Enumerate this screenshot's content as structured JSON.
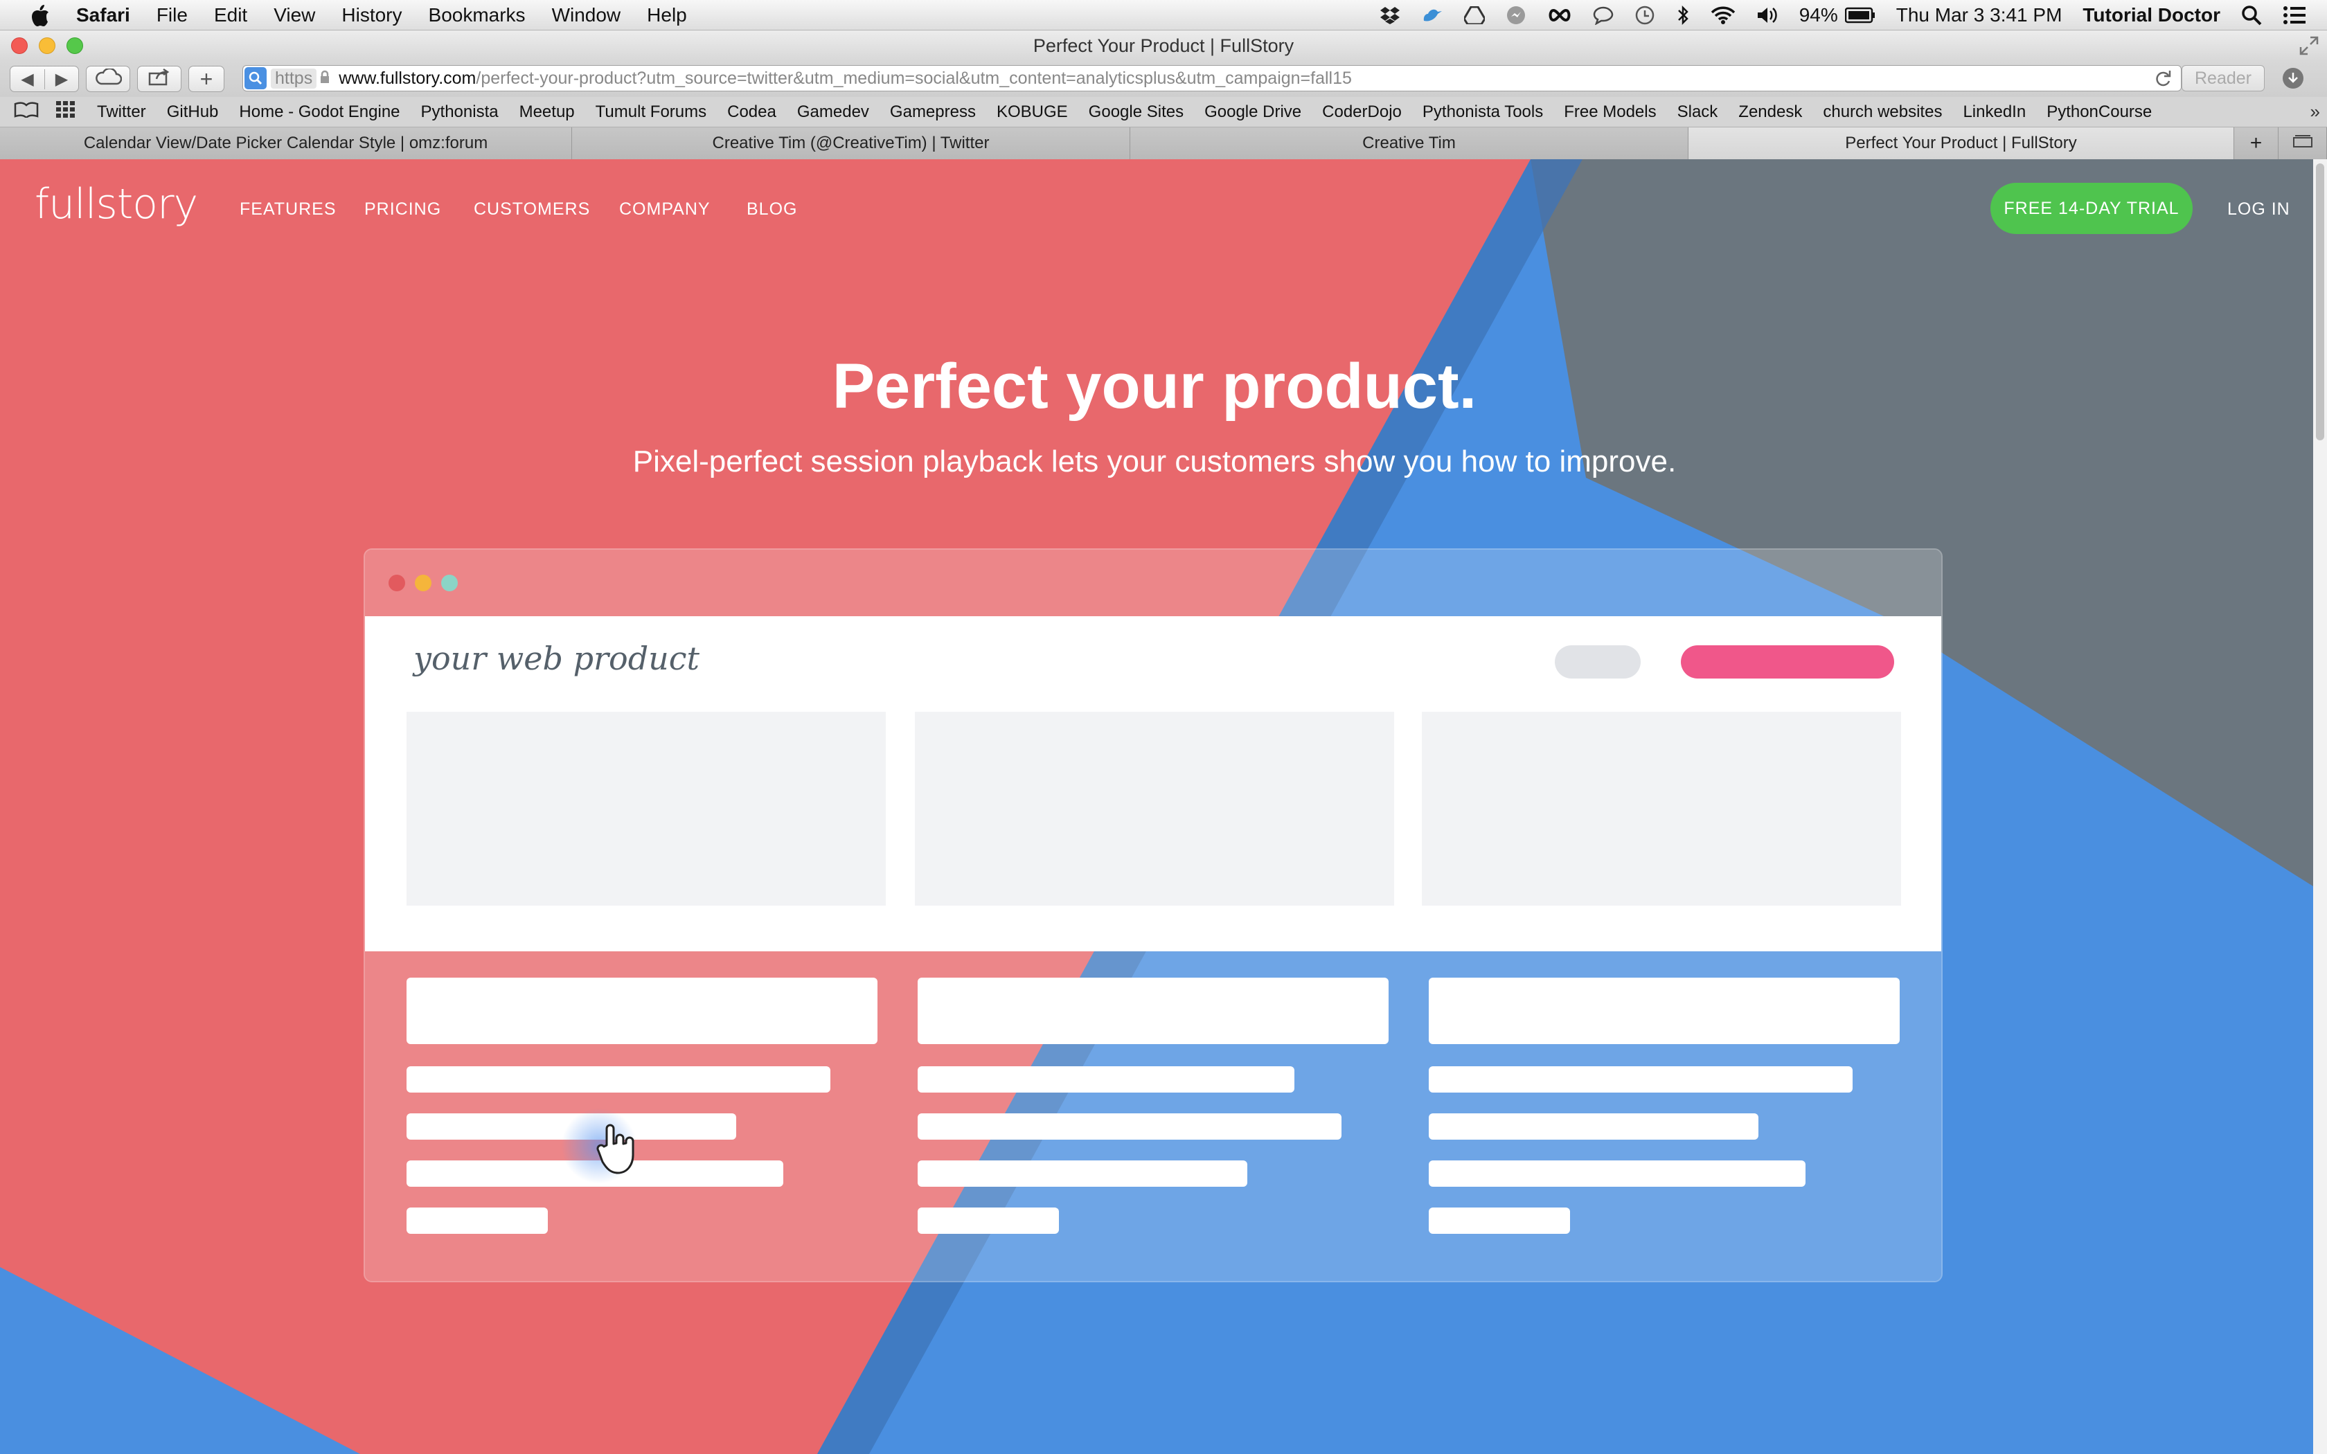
{
  "menubar": {
    "app": "Safari",
    "items": [
      "File",
      "Edit",
      "View",
      "History",
      "Bookmarks",
      "Window",
      "Help"
    ],
    "battery": "94%",
    "datetime": "Thu Mar 3  3:41 PM",
    "user": "Tutorial Doctor"
  },
  "window": {
    "title": "Perfect Your Product | FullStory"
  },
  "toolbar": {
    "address_scheme": "https",
    "address_host": "www.fullstory.com",
    "address_path": "/perfect-your-product?utm_source=twitter&utm_medium=social&utm_content=analyticsplus&utm_campaign=fall15",
    "reader_label": "Reader"
  },
  "bookmarks": [
    "Twitter",
    "GitHub",
    "Home - Godot Engine",
    "Pythonista",
    "Meetup",
    "Tumult Forums",
    "Codea",
    "Gamedev",
    "Gamepress",
    "KOBUGE",
    "Google Sites",
    "Google Drive",
    "CoderDojo",
    "Pythonista Tools",
    "Free Models",
    "Slack",
    "Zendesk",
    "church websites",
    "LinkedIn",
    "PythonCourse"
  ],
  "tabs": [
    {
      "label": "Calendar View/Date Picker Calendar Style | omz:forum"
    },
    {
      "label": "Creative Tim (@CreativeTim) | Twitter"
    },
    {
      "label": "Creative Tim"
    },
    {
      "label": "Perfect Your Product | FullStory"
    }
  ],
  "site": {
    "logo": "fullstory",
    "nav": [
      "FEATURES",
      "PRICING",
      "CUSTOMERS",
      "COMPANY",
      "BLOG"
    ],
    "trial_button": "FREE 14-DAY TRIAL",
    "login": "LOG IN",
    "headline": "Perfect your product.",
    "subhead": "Pixel-perfect session playback lets your customers show you how to improve.",
    "mock_label": "your web product"
  },
  "colors": {
    "red": "#e8686c",
    "slate": "#6b767f",
    "blue": "#4a8fe0",
    "green": "#4fc44e",
    "pink": "#f0578a"
  }
}
